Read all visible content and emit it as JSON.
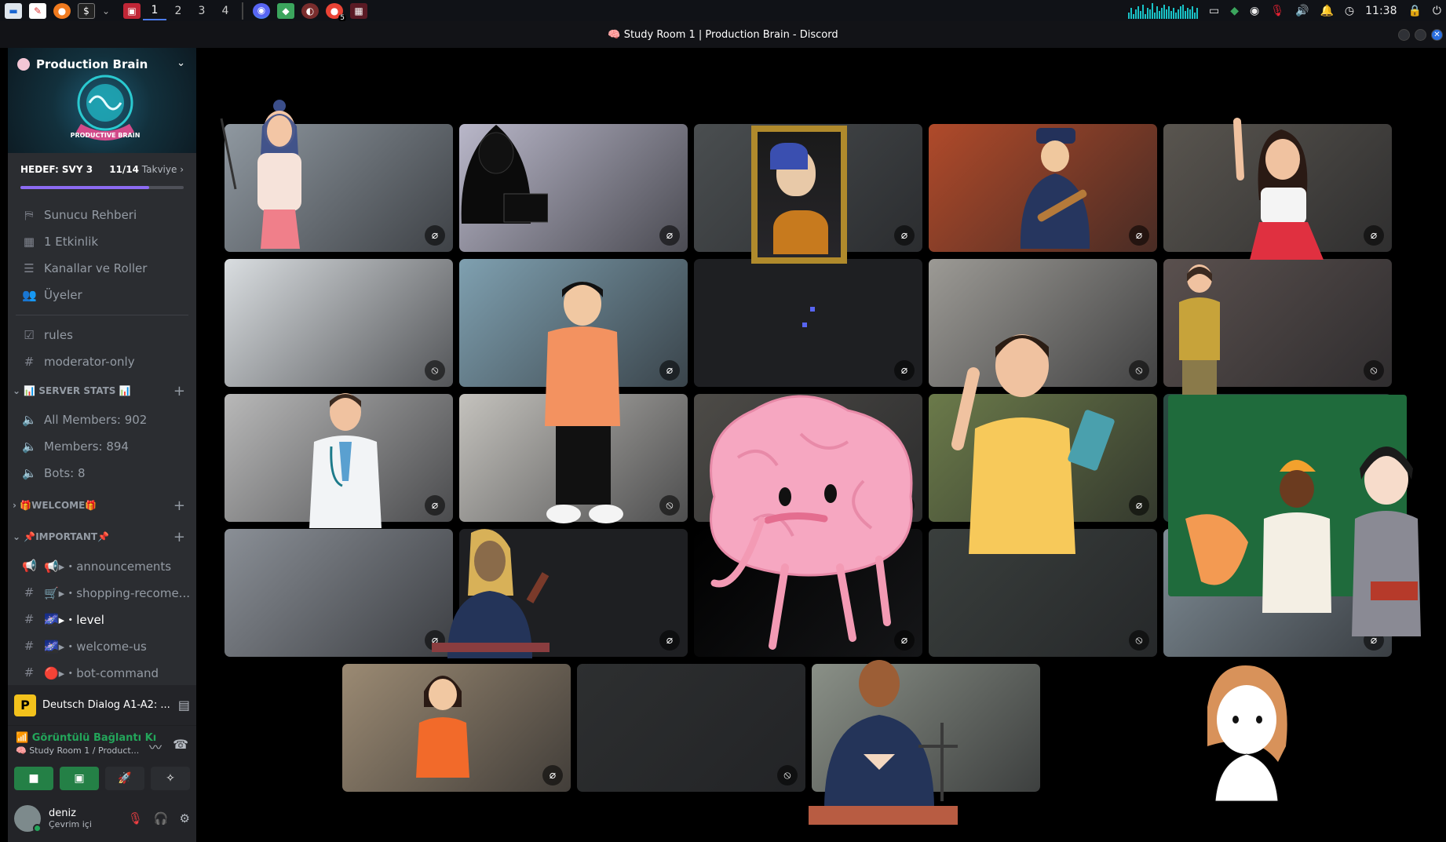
{
  "taskbar": {
    "workspaces": [
      "1",
      "2",
      "3",
      "4"
    ],
    "active_workspace": "1",
    "clock": "11:38",
    "chrome_badge": "5",
    "apps": [
      "files-icon",
      "document-icon",
      "firefox-icon",
      "terminal-icon"
    ],
    "tray_icons": [
      "audio-visualizer-icon",
      "screen-icon",
      "android-icon",
      "discord-icon",
      "mic-muted-icon",
      "volume-icon",
      "bell-icon",
      "clock-icon",
      "lock-icon",
      "power-icon"
    ]
  },
  "window": {
    "title": "🧠 Study Room 1 | Production Brain - Discord"
  },
  "server": {
    "name": "Production Brain",
    "banner_text": "PRODUCTIVE BRAIN",
    "boost_goal": "HEDEF: SVY 3",
    "boost_count": "11/14",
    "boost_label": "Takviye",
    "boost_progress": 0.79
  },
  "nav": {
    "items": [
      {
        "label": "Sunucu Rehberi",
        "icon": "signpost-icon"
      },
      {
        "label": "1 Etkinlik",
        "icon": "calendar-icon"
      },
      {
        "label": "Kanallar ve Roller",
        "icon": "channels-roles-icon"
      },
      {
        "label": "Üyeler",
        "icon": "members-icon"
      }
    ],
    "channels_top": [
      {
        "label": "rules",
        "icon": "rules-icon"
      },
      {
        "label": "moderator-only",
        "icon": "hash-lock-icon"
      }
    ],
    "categories": [
      {
        "label": "📊 SERVER STATS 📊",
        "channels": [
          {
            "label": "All Members: 902",
            "icon": "speaker-lock-icon"
          },
          {
            "label": "Members: 894",
            "icon": "speaker-lock-icon"
          },
          {
            "label": "Bots: 8",
            "icon": "speaker-lock-icon"
          }
        ]
      },
      {
        "label": "🎁WELCOME🎁",
        "collapsed": true,
        "channels": []
      },
      {
        "label": "📌IMPORTANT📌",
        "channels": [
          {
            "label": "📢▸・announcements",
            "icon": "megaphone-icon"
          },
          {
            "label": "🛒▸・shopping-recome...",
            "icon": "hash-icon"
          },
          {
            "label": "🌌▸・level",
            "icon": "hash-icon",
            "active": true
          },
          {
            "label": "🌌▸・welcome-us",
            "icon": "hash-icon"
          },
          {
            "label": "🔴▸・bot-command",
            "icon": "hash-icon"
          }
        ]
      }
    ]
  },
  "activity": {
    "icon_letter": "P",
    "label": "Deutsch Dialog A1-A2: ..."
  },
  "voice": {
    "status": "Görüntülü Bağlantı Kı",
    "channel": "🧠 Study Room 1 / Product..."
  },
  "user": {
    "name": "deniz",
    "status": "Çevrim içi"
  },
  "colors": {
    "accent": "#5865f2",
    "green": "#23a55a",
    "red": "#f23f43",
    "sidebar_bg": "#2b2d31",
    "panel_bg": "#232428"
  },
  "tiles": [
    {
      "name": "tile-1",
      "bg": "#8f98a0",
      "state": "mic-muted"
    },
    {
      "name": "tile-2",
      "bg": "#b9b7c9",
      "state": "mic-muted"
    },
    {
      "name": "tile-3",
      "bg": "#4a4e50",
      "state": "mic-muted"
    },
    {
      "name": "tile-4",
      "bg": "#b04a2a",
      "state": "mic-muted"
    },
    {
      "name": "tile-5",
      "bg": "#59554f",
      "state": "mic-muted"
    },
    {
      "name": "tile-6",
      "bg": "#d9dde0",
      "state": "deafened"
    },
    {
      "name": "tile-7",
      "bg": "#7fa0b0",
      "state": "mic-muted"
    },
    {
      "name": "tile-8",
      "bg": "#1e1f22",
      "state": "mic-muted"
    },
    {
      "name": "tile-9",
      "bg": "#9c9a95",
      "state": "deafened"
    },
    {
      "name": "tile-10",
      "bg": "#5a504e",
      "state": "deafened"
    },
    {
      "name": "tile-11",
      "bg": "#b8b8b8",
      "state": "mic-muted"
    },
    {
      "name": "tile-12",
      "bg": "#c4c2bd",
      "state": "deafened"
    },
    {
      "name": "tile-13",
      "bg": "#4d4b47",
      "state": "mic-muted"
    },
    {
      "name": "tile-14",
      "bg": "#6b7a4a",
      "state": "mic-muted"
    },
    {
      "name": "tile-15",
      "bg": "#2a4a42",
      "state": "mic-muted"
    },
    {
      "name": "tile-16",
      "bg": "#8a8f96",
      "state": "mic-muted"
    },
    {
      "name": "tile-17",
      "bg": "#1e1f22",
      "state": "mic-muted"
    },
    {
      "name": "tile-18",
      "bg": "#000000",
      "state": "mic-muted"
    },
    {
      "name": "tile-19",
      "bg": "#3a3f3d",
      "state": "deafened"
    },
    {
      "name": "tile-20",
      "bg": "#7f8c95",
      "state": "mic-muted"
    },
    {
      "name": "tile-21",
      "bg": "#9b8a73",
      "state": "mic-muted"
    },
    {
      "name": "tile-22",
      "bg": "#2d2f30",
      "state": "deafened"
    },
    {
      "name": "tile-23",
      "bg": "#8a9087",
      "state": "none"
    }
  ]
}
